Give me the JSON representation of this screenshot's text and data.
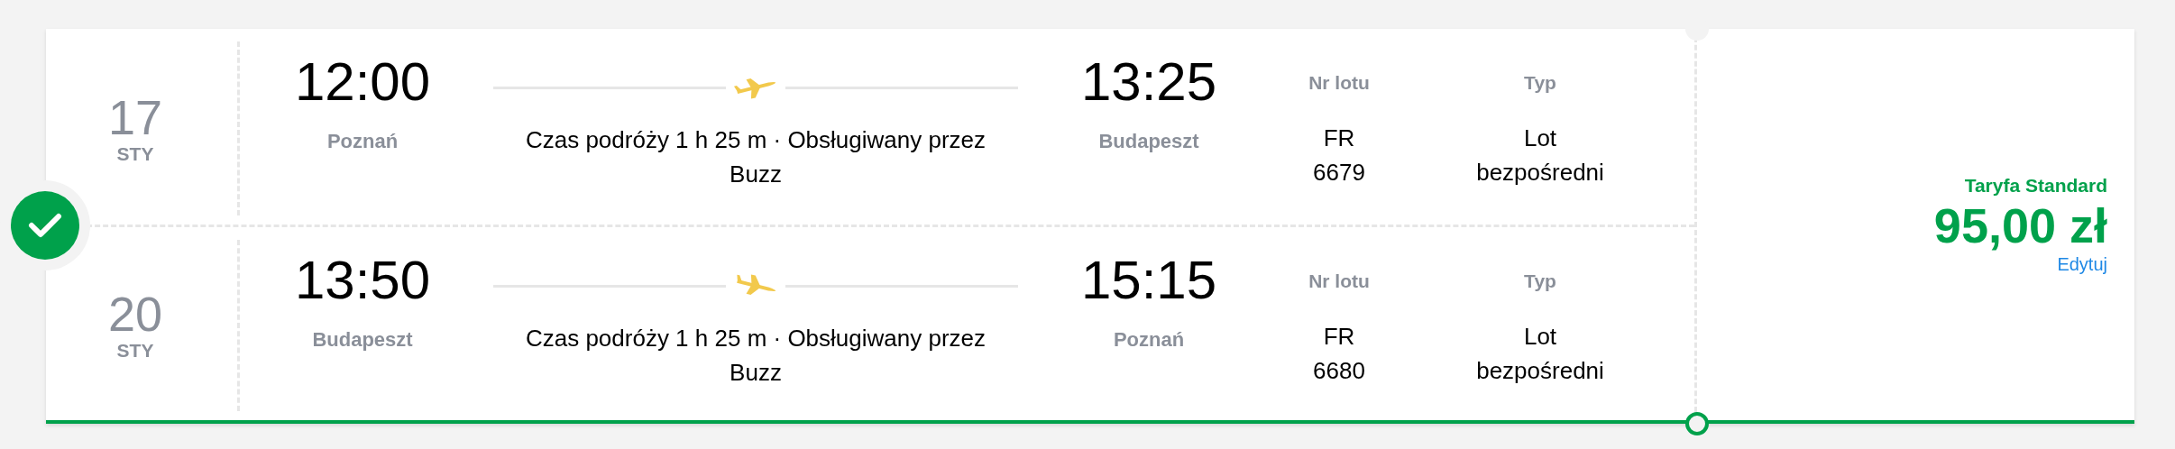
{
  "selected": true,
  "flights": [
    {
      "day": "17",
      "month": "STY",
      "departure": {
        "time": "12:00",
        "city": "Poznań"
      },
      "kind": "outbound",
      "duration": "Czas podróży 1 h 25 m · Obsługiwany przez Buzz",
      "arrival": {
        "time": "13:25",
        "city": "Budapeszt"
      },
      "flight_number_label": "Nr lotu",
      "flight_number": "FR 6679",
      "type_label": "Typ",
      "type": "Lot bezpośredni"
    },
    {
      "day": "20",
      "month": "STY",
      "departure": {
        "time": "13:50",
        "city": "Budapeszt"
      },
      "kind": "return",
      "duration": "Czas podróży 1 h 25 m · Obsługiwany przez Buzz",
      "arrival": {
        "time": "15:15",
        "city": "Poznań"
      },
      "flight_number_label": "Nr lotu",
      "flight_number": "FR 6680",
      "type_label": "Typ",
      "type": "Lot bezpośredni"
    }
  ],
  "fare": {
    "name": "Taryfa Standard",
    "price": "95,00 zł",
    "edit_link": "Edytuj"
  }
}
